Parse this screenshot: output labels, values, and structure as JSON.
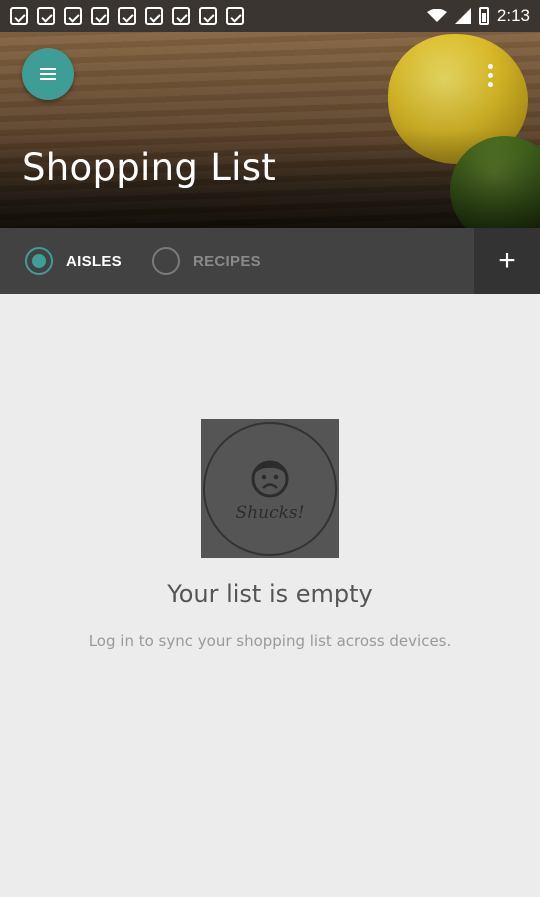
{
  "status_bar": {
    "time": "2:13"
  },
  "header": {
    "title": "Shopping List"
  },
  "toggle": {
    "options": [
      {
        "label": "AISLES",
        "selected": true
      },
      {
        "label": "RECIPES",
        "selected": false
      }
    ],
    "add_label": "+"
  },
  "empty_state": {
    "image_text": "Shucks!",
    "title": "Your list is empty",
    "subtitle": "Log in to sync your shopping list across devices."
  },
  "colors": {
    "accent": "#3f9d97",
    "toggle_bar": "#424242",
    "background": "#ececec"
  },
  "icons": {
    "menu": "hamburger-icon",
    "overflow": "more-vert-icon",
    "add": "plus-icon"
  }
}
